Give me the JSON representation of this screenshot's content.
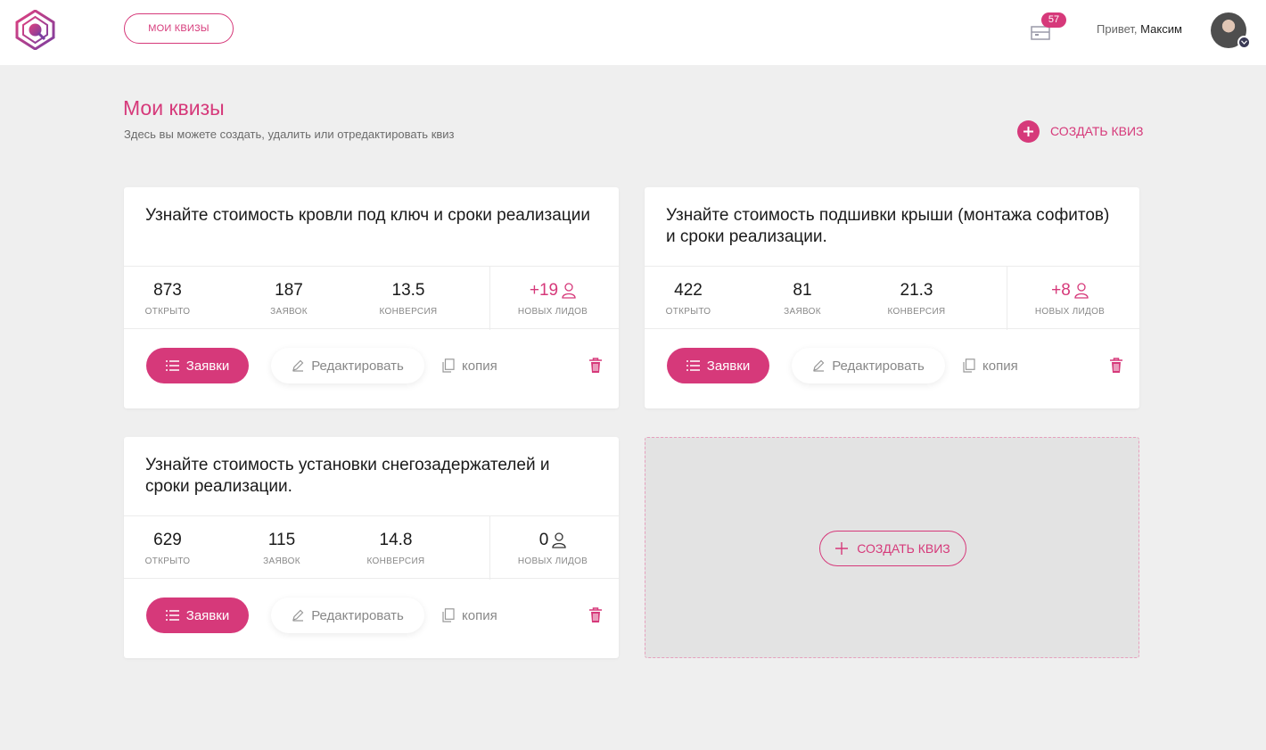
{
  "header": {
    "nav_button": "Мои квизы",
    "notifications_count": "57",
    "greeting_prefix": "Привет,",
    "user_name": "Максим"
  },
  "page": {
    "title": "Мои квизы",
    "subtitle": "Здесь вы можете создать, удалить или отредактировать квиз",
    "create_label": "Создать квиз"
  },
  "labels": {
    "opened": "открыто",
    "applications": "заявок",
    "conversion": "конверсия",
    "new_leads": "новых лидов",
    "apps_button": "Заявки",
    "edit_button": "Редактировать",
    "copy_button": "копия"
  },
  "quizzes": [
    {
      "title": "Узнайте стоимость кровли под ключ и сроки реализации",
      "opened": "873",
      "applications": "187",
      "conversion": "13.5",
      "new_leads": "+19"
    },
    {
      "title": "Узнайте стоимость подшивки крыши (монтажа софитов) и сроки реализации.",
      "opened": "422",
      "applications": "81",
      "conversion": "21.3",
      "new_leads": "+8"
    },
    {
      "title": "Узнайте стоимость установки снегозадержателей и сроки реализации.",
      "opened": "629",
      "applications": "115",
      "conversion": "14.8",
      "new_leads": "0"
    }
  ],
  "create_card": {
    "label": "Создать квиз"
  },
  "colors": {
    "accent": "#d6397a",
    "background": "#efefef"
  },
  "icons": [
    "logo-icon",
    "notifications-icon",
    "plus-icon",
    "list-icon",
    "pencil-icon",
    "copy-icon",
    "trash-icon",
    "user-icon"
  ]
}
